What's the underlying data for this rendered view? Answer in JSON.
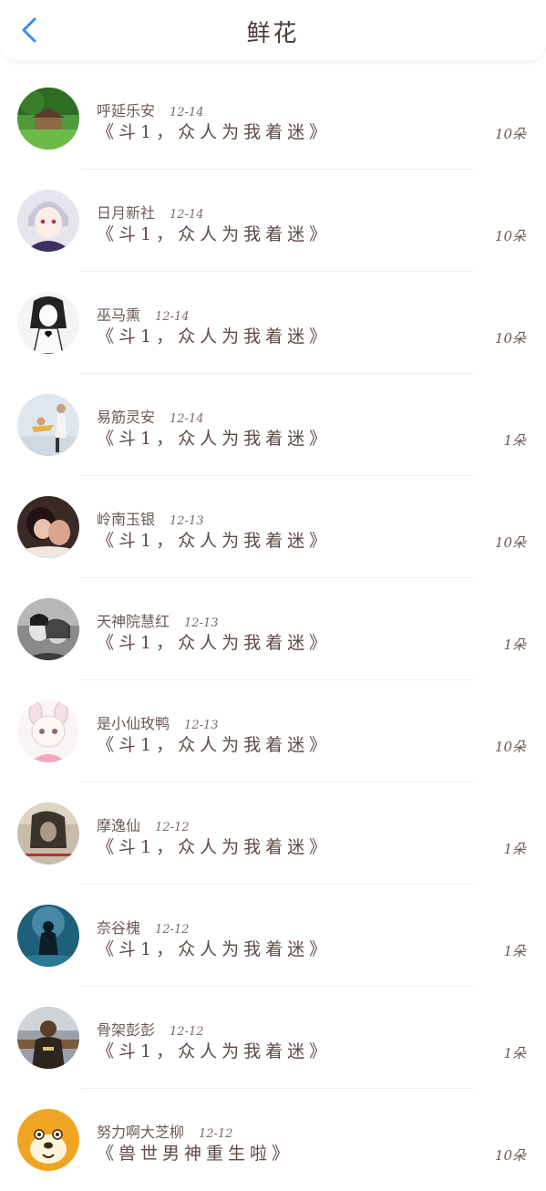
{
  "header": {
    "title": "鲜花",
    "back_icon": "chevron-left-icon",
    "accent": "#2f8ef0"
  },
  "rows": [
    {
      "name": "呼延乐安",
      "date": "12-14",
      "book": "《斗1，众人为我着迷》",
      "count": "10朵",
      "avatar": "avatar-landscape-cottage"
    },
    {
      "name": "日月新社",
      "date": "12-14",
      "book": "《斗1，众人为我着迷》",
      "count": "10朵",
      "avatar": "avatar-anime-boy"
    },
    {
      "name": "巫马熏",
      "date": "12-14",
      "book": "《斗1，众人为我着迷》",
      "count": "10朵",
      "avatar": "avatar-sketch-girl"
    },
    {
      "name": "易筋灵安",
      "date": "12-14",
      "book": "《斗1，众人为我着迷》",
      "count": "1朵",
      "avatar": "avatar-dancers"
    },
    {
      "name": "岭南玉银",
      "date": "12-13",
      "book": "《斗1，众人为我着迷》",
      "count": "10朵",
      "avatar": "avatar-couple-dark"
    },
    {
      "name": "天神院慧红",
      "date": "12-13",
      "book": "《斗1，众人为我着迷》",
      "count": "1朵",
      "avatar": "avatar-couple-bw"
    },
    {
      "name": "是小仙玫鸭",
      "date": "12-13",
      "book": "《斗1，众人为我着迷》",
      "count": "10朵",
      "avatar": "avatar-chibi-girl"
    },
    {
      "name": "摩逸仙",
      "date": "12-12",
      "book": "《斗1，众人为我着迷》",
      "count": "1朵",
      "avatar": "avatar-sepia-girl"
    },
    {
      "name": "奈谷槐",
      "date": "12-12",
      "book": "《斗1，众人为我着迷》",
      "count": "1朵",
      "avatar": "avatar-night-figure"
    },
    {
      "name": "骨架彭彭",
      "date": "12-12",
      "book": "《斗1，众人为我着迷》",
      "count": "1朵",
      "avatar": "avatar-man-photo"
    },
    {
      "name": "努力啊大芝柳",
      "date": "12-12",
      "book": "《兽世男神重生啦》",
      "count": "10朵",
      "avatar": "avatar-cartoon-dog"
    }
  ]
}
